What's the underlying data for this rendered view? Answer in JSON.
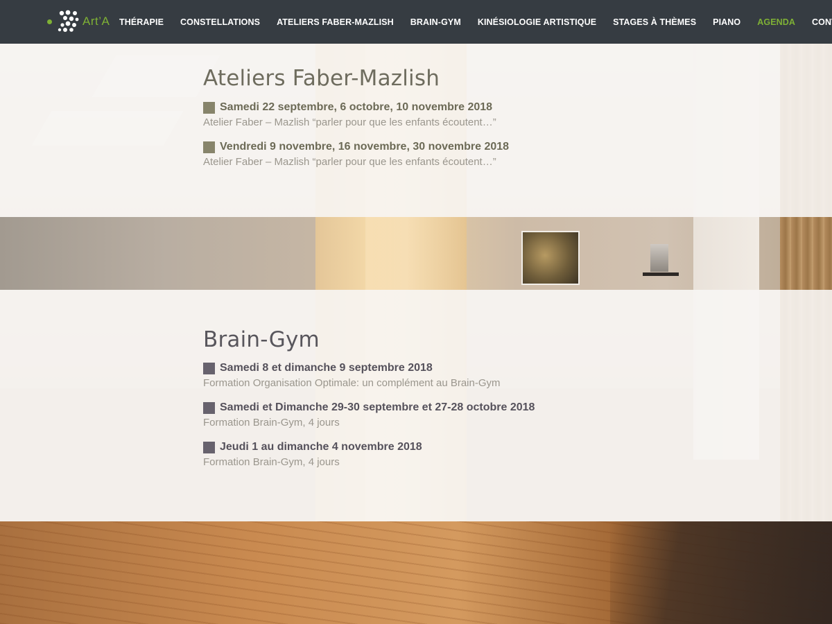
{
  "brand": {
    "logo_text": "Art’A",
    "accent_color": "#7fb135",
    "header_bg": "#363c42"
  },
  "nav": {
    "items": [
      {
        "label": "THÉRAPIE"
      },
      {
        "label": "CONSTELLATIONS"
      },
      {
        "label": "ATELIERS FABER-MAZLISH"
      },
      {
        "label": "BRAIN-GYM"
      },
      {
        "label": "KINÉSIOLOGIE ARTISTIQUE"
      },
      {
        "label": "STAGES À THÈMES"
      },
      {
        "label": "PIANO"
      },
      {
        "label": "AGENDA",
        "active": true
      },
      {
        "label": "CONTACT"
      }
    ]
  },
  "sections": [
    {
      "title": "Ateliers Faber-Mazlish",
      "square_color": "#87846b",
      "events": [
        {
          "date": "Samedi 22 septembre, 6 octobre, 10 novembre 2018",
          "desc": "Atelier Faber – Mazlish “parler pour que les enfants écoutent…”"
        },
        {
          "date": "Vendredi 9 novembre, 16 novembre, 30 novembre 2018",
          "desc": "Atelier Faber – Mazlish “parler pour que les enfants écoutent…”"
        }
      ]
    },
    {
      "title": "Brain-Gym",
      "square_color": "#67626d",
      "events": [
        {
          "date": "Samedi 8 et dimanche 9 septembre 2018",
          "desc": "Formation Organisation Optimale: un complément au Brain-Gym"
        },
        {
          "date": "Samedi et Dimanche 29-30 septembre et 27-28 octobre 2018",
          "desc": "Formation Brain-Gym, 4 jours"
        },
        {
          "date": "Jeudi 1 au dimanche 4 novembre 2018",
          "desc": "Formation Brain-Gym, 4 jours"
        }
      ]
    }
  ]
}
